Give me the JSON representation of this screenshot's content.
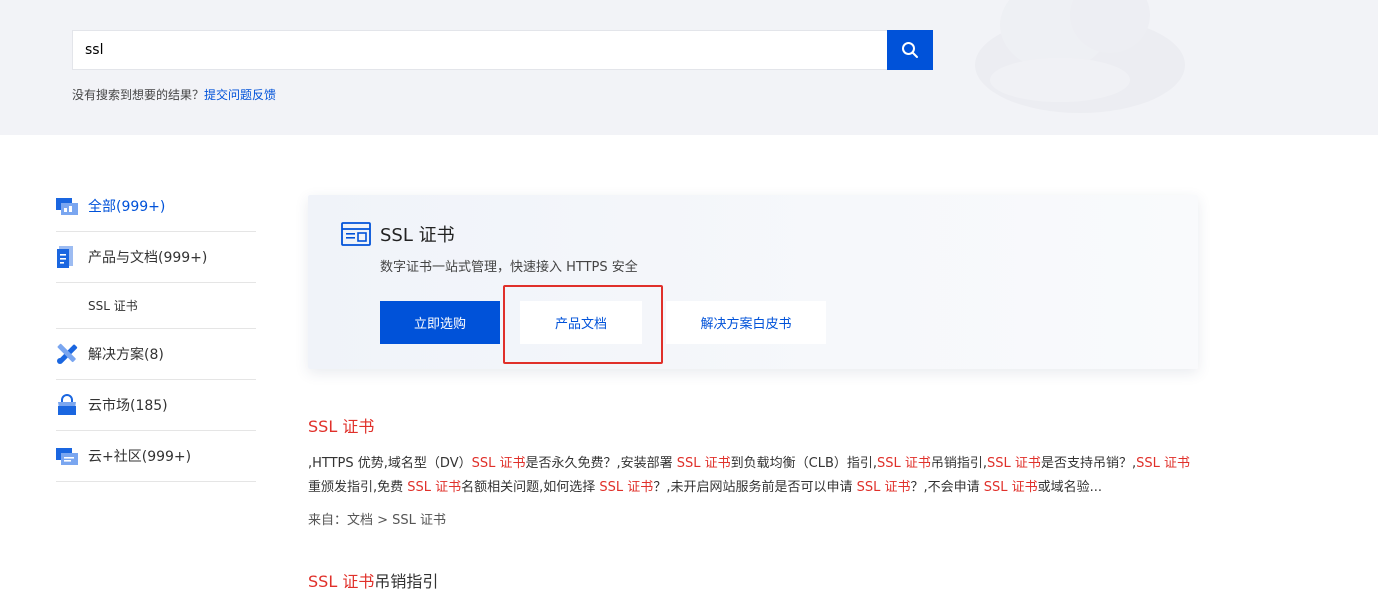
{
  "search": {
    "value": "ssl",
    "button_icon": "search-icon",
    "feedback_text": "没有搜索到想要的结果？",
    "feedback_link": "提交问题反馈"
  },
  "sidebar": {
    "items": [
      {
        "label": "全部(999+)",
        "icon": "all-icon",
        "active": true
      },
      {
        "label": "产品与文档(999+)",
        "icon": "document-icon"
      },
      {
        "label": "SSL 证书",
        "sub": true
      },
      {
        "label": "解决方案(8)",
        "icon": "tools-icon"
      },
      {
        "label": "云市场(185)",
        "icon": "shopping-bag-icon"
      },
      {
        "label": "云+社区(999+)",
        "icon": "community-icon"
      }
    ]
  },
  "product_card": {
    "icon": "certificate-icon",
    "title": "SSL 证书",
    "description": "数字证书一站式管理，快速接入 HTTPS 安全",
    "buttons": {
      "buy": "立即选购",
      "docs": "产品文档",
      "solution": "解决方案白皮书"
    }
  },
  "results": [
    {
      "title_hl": "SSL 证书",
      "title_rest": "",
      "snippet": [
        {
          "t": ",HTTPS 优势,域名型（DV）"
        },
        {
          "t": "SSL 证书",
          "hl": true
        },
        {
          "t": "是否永久免费？,安装部署 "
        },
        {
          "t": "SSL 证书",
          "hl": true
        },
        {
          "t": "到负载均衡（CLB）指引,"
        },
        {
          "t": "SSL 证书",
          "hl": true
        },
        {
          "t": "吊销指引,"
        },
        {
          "t": "SSL 证书",
          "hl": true
        },
        {
          "t": "是否支持吊销？,"
        },
        {
          "t": "SSL 证书",
          "hl": true
        },
        {
          "t": "重颁发指引,免费 "
        },
        {
          "t": "SSL 证书",
          "hl": true
        },
        {
          "t": "名额相关问题,如何选择 "
        },
        {
          "t": "SSL 证书",
          "hl": true
        },
        {
          "t": "？,未开启网站服务前是否可以申请 "
        },
        {
          "t": "SSL 证书",
          "hl": true
        },
        {
          "t": "？,不会申请 "
        },
        {
          "t": "SSL 证书",
          "hl": true
        },
        {
          "t": "或域名验..."
        }
      ],
      "source": "来自：文档 > SSL 证书"
    },
    {
      "title_hl": "SSL 证书",
      "title_rest": "吊销指引"
    }
  ]
}
